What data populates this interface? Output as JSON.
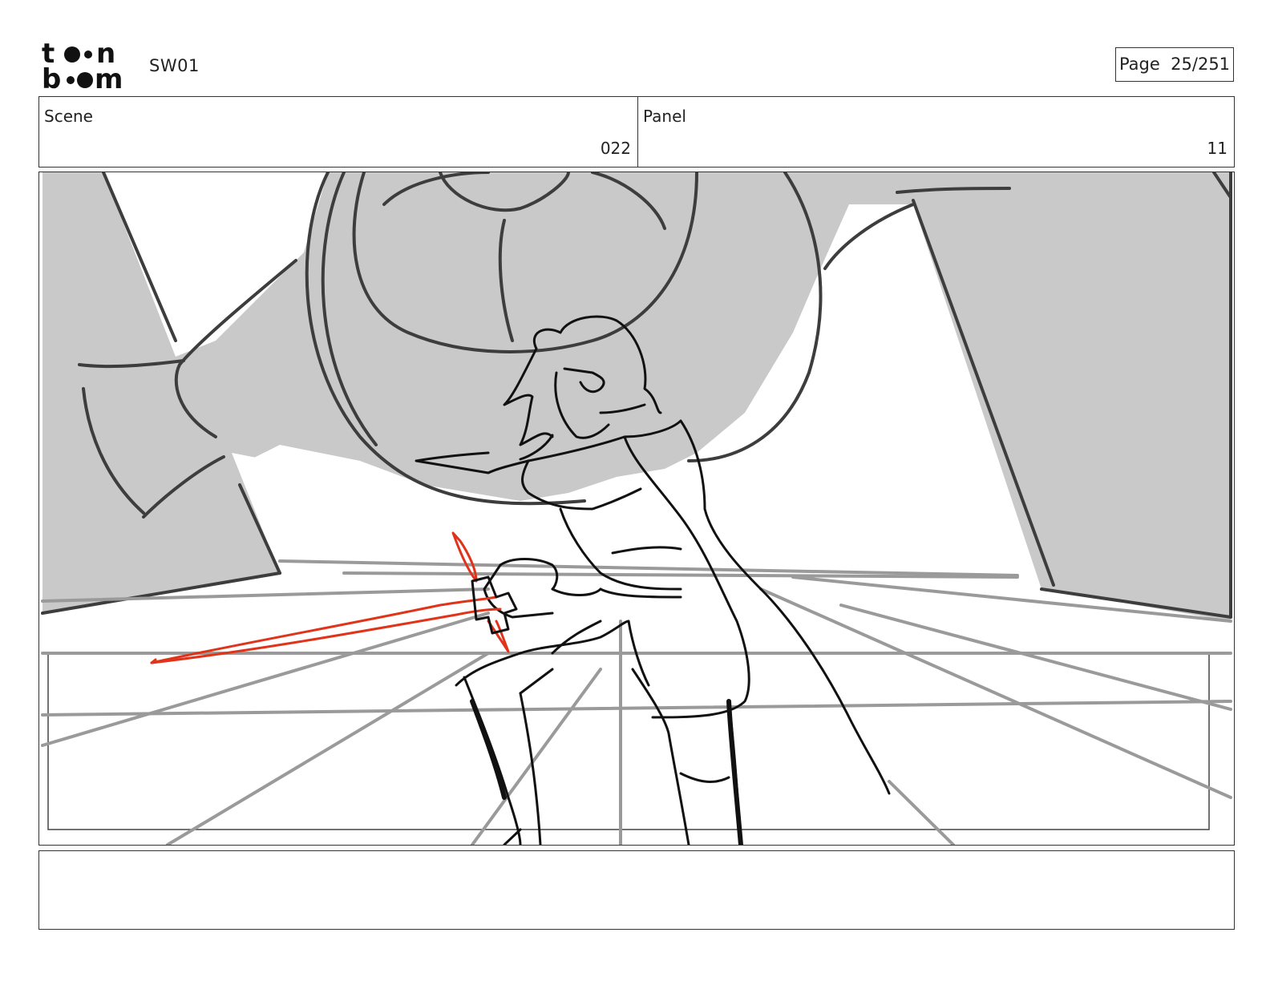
{
  "header": {
    "logo": {
      "icon": "toonboom-logo",
      "line1": "t",
      "line2": "b",
      "line3": "n",
      "line4": "m"
    },
    "project_name": "SW01",
    "page_label": "Page",
    "page_value": "25/251"
  },
  "info": {
    "scene_label": "Scene",
    "scene_value": "022",
    "panel_label": "Panel",
    "panel_value": "11"
  },
  "artwork": {
    "icon": "storyboard-sketch-duelist-with-red-saber",
    "accent_color": "#e0341a",
    "shadow_color": "#c8c8c8"
  },
  "caption": {
    "text": ""
  }
}
